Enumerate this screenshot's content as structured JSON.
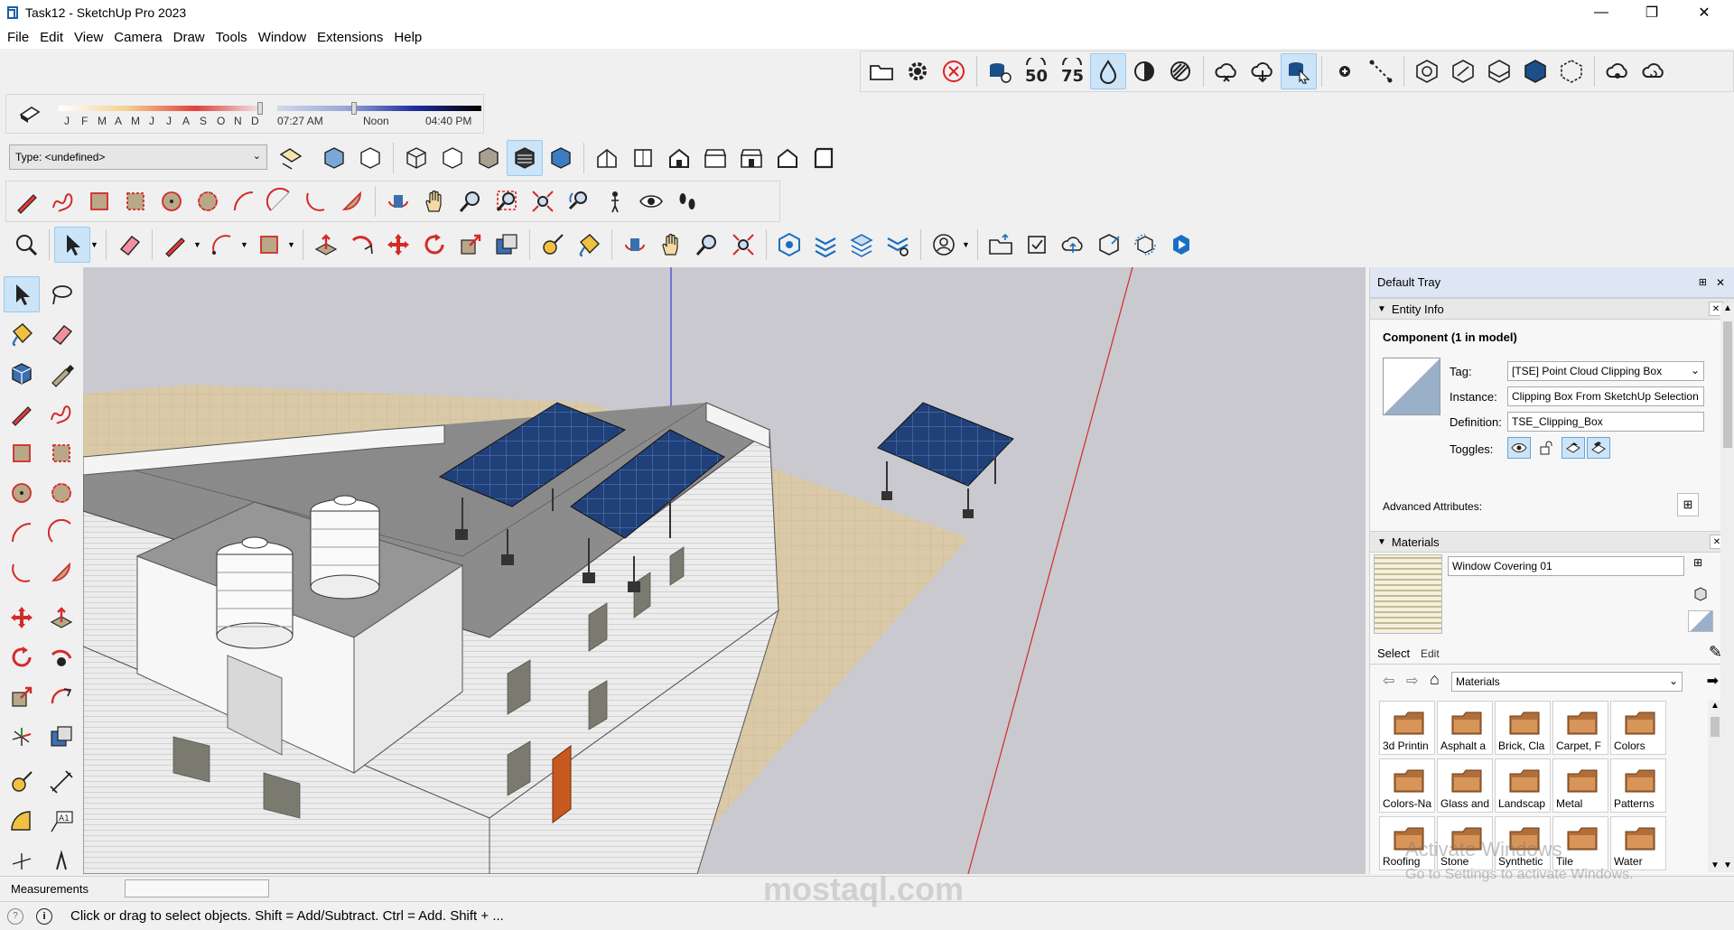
{
  "window": {
    "title": "Task12 - SketchUp Pro 2023",
    "minimize": "—",
    "restore": "❐",
    "close": "✕"
  },
  "menu": [
    "File",
    "Edit",
    "View",
    "Camera",
    "Draw",
    "Tools",
    "Window",
    "Extensions",
    "Help"
  ],
  "shadows": {
    "months": [
      "J",
      "F",
      "M",
      "A",
      "M",
      "J",
      "J",
      "A",
      "S",
      "O",
      "N",
      "D"
    ],
    "time_start": "07:27 AM",
    "time_mid": "Noon",
    "time_end": "04:40 PM"
  },
  "type_select": {
    "value": "Type: <undefined>"
  },
  "tray": {
    "title": "Default Tray",
    "entity_info": {
      "header": "Entity Info",
      "component_title": "Component (1 in model)",
      "tag_label": "Tag:",
      "tag_value": "[TSE] Point Cloud Clipping Box",
      "instance_label": "Instance:",
      "instance_value": "Clipping Box From SketchUp Selection",
      "definition_label": "Definition:",
      "definition_value": "TSE_Clipping_Box",
      "toggles_label": "Toggles:",
      "advanced_label": "Advanced Attributes:"
    },
    "materials": {
      "header": "Materials",
      "current_name": "Window Covering 01",
      "tab_select": "Select",
      "tab_edit": "Edit",
      "library": "Materials",
      "items": [
        "3d Printin",
        "Asphalt a",
        "Brick, Cla",
        "Carpet, F",
        "Colors",
        "Colors-Na",
        "Glass and",
        "Landscap",
        "Metal",
        "Patterns",
        "Roofing",
        "Stone",
        "Synthetic",
        "Tile",
        "Water"
      ]
    }
  },
  "measurements": {
    "label": "Measurements",
    "value": ""
  },
  "status": {
    "hint": "Click or drag to select objects. Shift = Add/Subtract. Ctrl = Add. Shift + ..."
  },
  "watermarks": {
    "activate_title": "Activate Windows",
    "activate_sub": "Go to Settings to activate Windows.",
    "site": "mostaql.com"
  }
}
